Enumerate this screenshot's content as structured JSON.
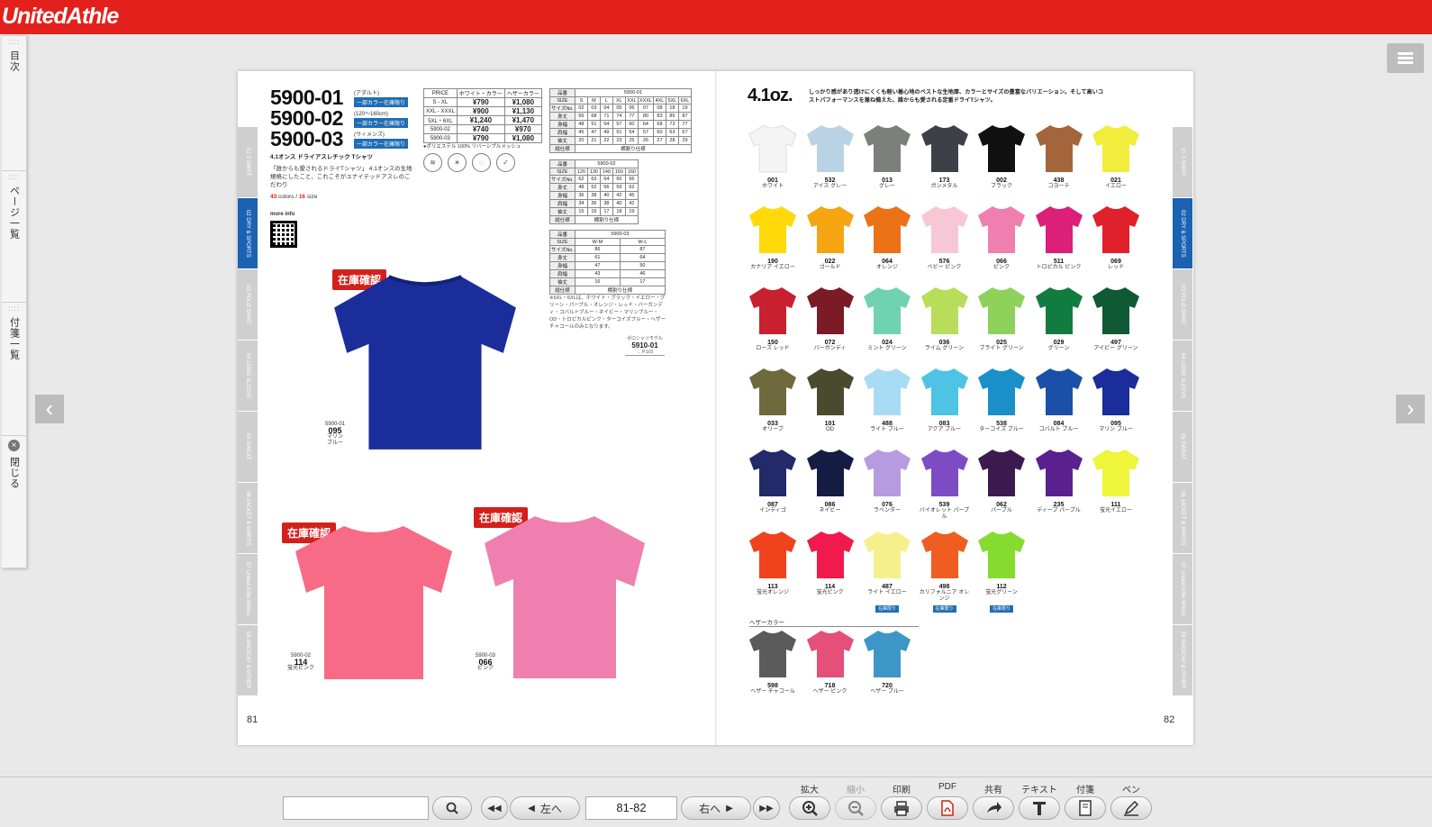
{
  "header": {
    "logo_text": "UnitedAthle"
  },
  "left_tabs": [
    {
      "label": "目次"
    },
    {
      "label": "ページ一覧"
    },
    {
      "label": "付箋一覧"
    },
    {
      "label": "閉じる"
    }
  ],
  "page_index_tabs": [
    "01 T-SHIRT",
    "02 DRY & SPORTS",
    "03 POLO SHIRT",
    "04 LONG SLEEVE",
    "05 SWEAT",
    "06 JACKET & SHIRTS",
    "07 United Athle Works",
    "08 BAG/CAP & OTHER"
  ],
  "left_page": {
    "codes": [
      {
        "code": "5900-01",
        "sub": "(アダルト)",
        "badge": "一部カラー在庫限り"
      },
      {
        "code": "5900-02",
        "sub": "(120〜160cm)",
        "badge": "一部カラー在庫限り"
      },
      {
        "code": "5900-03",
        "sub": "(ウィメンズ)",
        "badge": "一部カラー在庫限り"
      }
    ],
    "product_name": "4.1オンス ドライアスレチック Tシャツ",
    "description": "「誰からも愛されるドライTシャツ」 4.1オンスの生地規格にしたこと、これこそがユナイテッドアスレのこだわり",
    "count_colors": "43",
    "count_colors_label": "colors /",
    "count_sizes": "16",
    "count_sizes_label": "size",
    "more_info": "more info",
    "price_table": {
      "head": [
        "PRICE",
        "ホワイト・カラー",
        "ヘザーカラー"
      ],
      "rows": [
        [
          "S - XL",
          "¥790",
          "¥1,080"
        ],
        [
          "XXL - XXXL",
          "¥900",
          "¥1,130"
        ],
        [
          "5XL・6XL",
          "¥1,240",
          "¥1,470"
        ],
        [
          "5900-02",
          "¥740",
          "¥970"
        ],
        [
          "5900-03",
          "¥790",
          "¥1,080"
        ]
      ]
    },
    "material_note": "●ポリエステル 100% リバーシブルメッシュ",
    "feature_icons": [
      "DRY 吸水速乾",
      "紫外線遮蔽",
      "消臭機能",
      "プリント"
    ],
    "size_note": "※5XL・6XLは、ホワイト・ブラック・イエロー・グリーン・パープル・オレンジ・レッド・バーガンディ・コバルトブルー・ネイビー・マリンブルー・OD・トロピカルピンク・ターコイズブルー・ヘザーチャコールのみとなります。",
    "related_label": "ポロシャツモデル",
    "related_code": "5910-01",
    "related_page": "→ P.101",
    "stock_badge": "在庫確認",
    "main_shirt": {
      "model": "5900-01",
      "code": "095",
      "name": "マリン ブルー"
    },
    "shirt_b": {
      "model": "5900-02",
      "code": "114",
      "name": "蛍光ピンク"
    },
    "shirt_c": {
      "model": "5900-03",
      "code": "066",
      "name": "ピンク"
    },
    "page_number": "81"
  },
  "right_page": {
    "weight": "4.1oz.",
    "description": "しっかり感があり透けにくくも軽い着心地のベストな生地厚、カラーとサイズの豊富なバリエーション。そして高いコストパフォーマンスを兼ね備えた、誰からも愛される定番ドライTシャツ。",
    "limited_label": "在庫限り",
    "heather_label": "ヘザーカラー",
    "swatches": [
      [
        {
          "code": "001",
          "name": "ホワイト",
          "color": "#f4f4f4"
        },
        {
          "code": "532",
          "name": "アイス グレー",
          "color": "#b9d3e4"
        },
        {
          "code": "013",
          "name": "グレー",
          "color": "#7d7f7a"
        },
        {
          "code": "173",
          "name": "ガンメタル",
          "color": "#3d4147"
        },
        {
          "code": "002",
          "name": "ブラック",
          "color": "#111111"
        },
        {
          "code": "438",
          "name": "コヨーテ",
          "color": "#a3653c"
        },
        {
          "code": "021",
          "name": "イエロー",
          "color": "#f2ec3c"
        }
      ],
      [
        {
          "code": "190",
          "name": "カナリア イエロー",
          "color": "#ffd90a"
        },
        {
          "code": "022",
          "name": "ゴールド",
          "color": "#f5a511"
        },
        {
          "code": "064",
          "name": "オレンジ",
          "color": "#ec7217"
        },
        {
          "code": "576",
          "name": "ベビー ピンク",
          "color": "#f7c7d6"
        },
        {
          "code": "066",
          "name": "ピンク",
          "color": "#ef7fae"
        },
        {
          "code": "511",
          "name": "トロピカル ピンク",
          "color": "#dc1f79"
        },
        {
          "code": "069",
          "name": "レッド",
          "color": "#e0212b"
        }
      ],
      [
        {
          "code": "150",
          "name": "ローズ レッド",
          "color": "#c8202e"
        },
        {
          "code": "072",
          "name": "バーガンディ",
          "color": "#7b1b26"
        },
        {
          "code": "024",
          "name": "ミント グリーン",
          "color": "#6fd2b0"
        },
        {
          "code": "036",
          "name": "ライム グリーン",
          "color": "#b8dd5a"
        },
        {
          "code": "025",
          "name": "ブライト グリーン",
          "color": "#8ed15b"
        },
        {
          "code": "029",
          "name": "グリーン",
          "color": "#127c40"
        },
        {
          "code": "497",
          "name": "アイビー グリーン",
          "color": "#0f5a34"
        }
      ],
      [
        {
          "code": "033",
          "name": "オリーブ",
          "color": "#6f6a3e"
        },
        {
          "code": "101",
          "name": "OD",
          "color": "#4a4a2f"
        },
        {
          "code": "488",
          "name": "ライト ブルー",
          "color": "#a8dcf2"
        },
        {
          "code": "083",
          "name": "アクア ブルー",
          "color": "#4ec3e4"
        },
        {
          "code": "538",
          "name": "ターコイズ ブルー",
          "color": "#1b8fc7"
        },
        {
          "code": "084",
          "name": "コバルト ブルー",
          "color": "#1b50a8"
        },
        {
          "code": "095",
          "name": "マリン ブルー",
          "color": "#1a2d9a"
        }
      ],
      [
        {
          "code": "087",
          "name": "インディゴ",
          "color": "#232a6a"
        },
        {
          "code": "086",
          "name": "ネイビー",
          "color": "#141c44"
        },
        {
          "code": "076",
          "name": "ラベンダー",
          "color": "#b79be0"
        },
        {
          "code": "539",
          "name": "バイオレット パープル",
          "color": "#7d4cc5"
        },
        {
          "code": "062",
          "name": "パープル",
          "color": "#3d1a4e"
        },
        {
          "code": "235",
          "name": "ディープ パープル",
          "color": "#5a218e"
        },
        {
          "code": "111",
          "name": "蛍光イエロー",
          "color": "#eef53a"
        }
      ],
      [
        {
          "code": "113",
          "name": "蛍光オレンジ",
          "color": "#f0421d",
          "limited": false
        },
        {
          "code": "114",
          "name": "蛍光ピンク",
          "color": "#f01a4c",
          "limited": false
        },
        {
          "code": "487",
          "name": "ライト イエロー",
          "color": "#f6f08c",
          "limited": true
        },
        {
          "code": "498",
          "name": "カリフォルニア オレンジ",
          "color": "#f05d20",
          "limited": true
        },
        {
          "code": "112",
          "name": "蛍光グリーン",
          "color": "#86db2f",
          "limited": true
        }
      ],
      [
        {
          "code": "598",
          "name": "ヘザー チャコール",
          "color": "#5b5b5b"
        },
        {
          "code": "718",
          "name": "ヘザー ピンク",
          "color": "#e4507a"
        },
        {
          "code": "720",
          "name": "ヘザー ブルー",
          "color": "#3e96c8"
        }
      ]
    ],
    "page_number": "82"
  },
  "toolbar": {
    "search_placeholder": "",
    "prev_label": "左へ",
    "next_label": "右へ",
    "page_value": "81-82",
    "tools": [
      {
        "label": "拡大",
        "icon": "zoom-in-icon"
      },
      {
        "label": "縮小",
        "icon": "zoom-out-icon"
      },
      {
        "label": "印刷",
        "icon": "print-icon"
      },
      {
        "label": "PDF",
        "icon": "pdf-icon"
      },
      {
        "label": "共有",
        "icon": "share-icon"
      },
      {
        "label": "テキスト",
        "icon": "text-icon"
      },
      {
        "label": "付箋",
        "icon": "sticky-note-icon"
      },
      {
        "label": "ペン",
        "icon": "pen-icon"
      }
    ]
  }
}
